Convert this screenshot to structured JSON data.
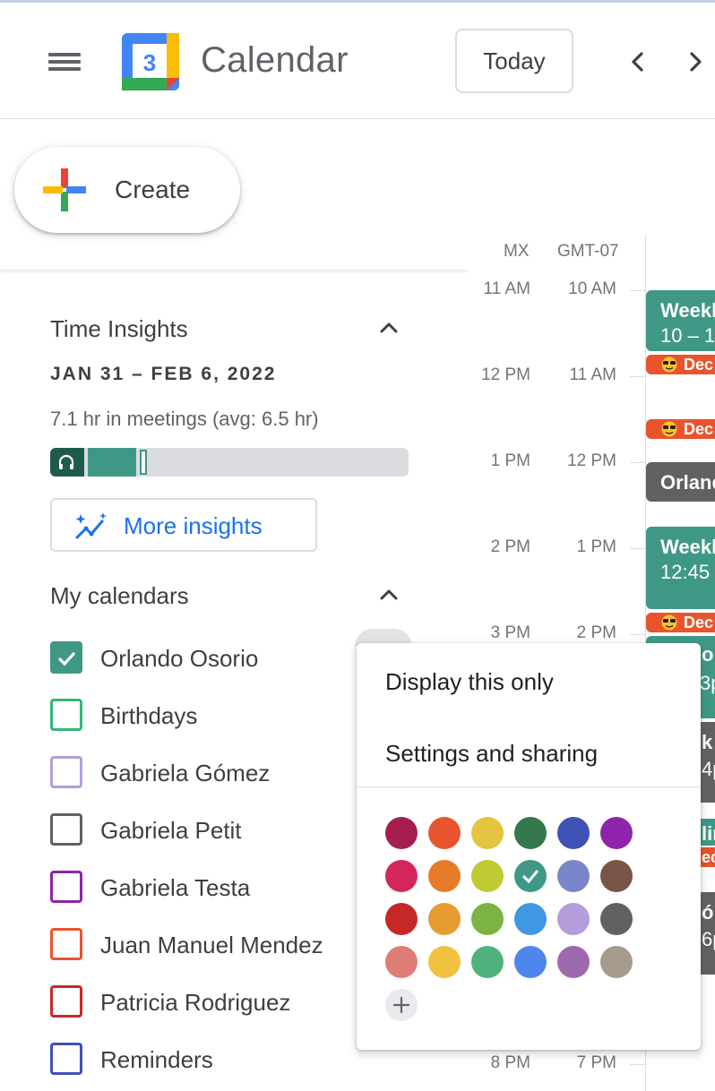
{
  "header": {
    "app_title": "Calendar",
    "logo_day": "3",
    "today_label": "Today",
    "menu_icon": "hamburger-menu-icon",
    "prev_icon": "chevron-left-icon",
    "next_icon": "chevron-right-icon"
  },
  "sidebar": {
    "create_label": "Create",
    "time_insights": {
      "title": "Time Insights",
      "date_range": "JAN 31 – FEB 6, 2022",
      "meeting_summary": "7.1 hr in meetings (avg: 6.5 hr)",
      "more_insights_label": "More insights"
    },
    "my_calendars": {
      "title": "My calendars",
      "items": [
        {
          "label": "Orlando Osorio",
          "color": "#3f9886",
          "checked": true
        },
        {
          "label": "Birthdays",
          "color": "#33b679",
          "checked": false
        },
        {
          "label": "Gabriela Gómez",
          "color": "#b39ddb",
          "checked": false
        },
        {
          "label": "Gabriela Petit",
          "color": "#616161",
          "checked": false
        },
        {
          "label": "Gabriela Testa",
          "color": "#8e24aa",
          "checked": false
        },
        {
          "label": "Juan Manuel Mendez",
          "color": "#e8542d",
          "checked": false
        },
        {
          "label": "Patricia Rodriguez",
          "color": "#c62828",
          "checked": false
        },
        {
          "label": "Reminders",
          "color": "#3f51b5",
          "checked": false
        }
      ]
    }
  },
  "timezones": {
    "primary": "MX",
    "secondary": "GMT-07"
  },
  "time_rows": [
    {
      "mx": "11 AM",
      "gmt": "10 AM"
    },
    {
      "mx": "12 PM",
      "gmt": "11 AM"
    },
    {
      "mx": "1 PM",
      "gmt": "12 PM"
    },
    {
      "mx": "2 PM",
      "gmt": "1 PM"
    },
    {
      "mx": "3 PM",
      "gmt": "2 PM"
    },
    {
      "mx": "8 PM",
      "gmt": "7 PM"
    }
  ],
  "events": {
    "weekly_1": {
      "title": "Weekl",
      "time": "10 – 1"
    },
    "dec_label": "Dec",
    "orlando": {
      "title": "Orland"
    },
    "weekly_2": {
      "title": "Weekl",
      "time": "12:45"
    },
    "frag_1": {
      "title": "o l",
      "time": "3p"
    },
    "frag_2": {
      "title": "k",
      "time": "4p"
    },
    "frag_3": {
      "title": "lin",
      "time": "ec"
    },
    "frag_4": {
      "title": "ó",
      "time": "6p"
    }
  },
  "popup": {
    "display_only": "Display this only",
    "settings_sharing": "Settings and sharing",
    "selected_color": "#3f9886",
    "colors": [
      [
        "#a51e4f",
        "#e8542d",
        "#e4c441",
        "#33784a",
        "#3f51b5",
        "#8e24aa"
      ],
      [
        "#d3275b",
        "#e67c2a",
        "#c0ca33",
        "#3f9886",
        "#7986cb",
        "#795548"
      ],
      [
        "#c62828",
        "#e69c31",
        "#7cb342",
        "#3f98e1",
        "#b39ddb",
        "#616161"
      ],
      [
        "#e07c76",
        "#f0c240",
        "#4fb27d",
        "#4f86ec",
        "#9e69af",
        "#a79b8e"
      ]
    ],
    "add_color_icon": "plus-icon"
  }
}
